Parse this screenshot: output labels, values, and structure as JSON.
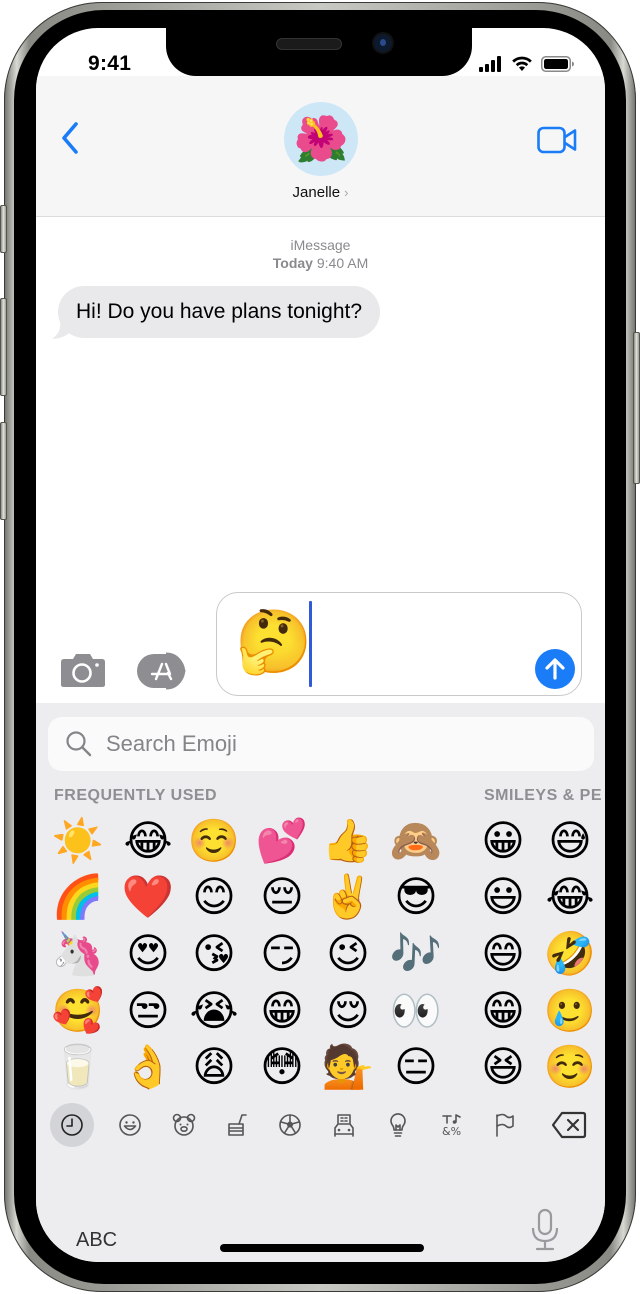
{
  "status_bar": {
    "time": "9:41",
    "icons": [
      "cellular-signal-icon",
      "wifi-icon",
      "battery-icon"
    ]
  },
  "header": {
    "back_icon": "chevron-left-icon",
    "contact": {
      "avatar_emoji": "🌺",
      "name": "Janelle",
      "chevron": "›"
    },
    "video_icon": "video-camera-icon"
  },
  "conversation": {
    "service": "iMessage",
    "timestamp_day": "Today",
    "timestamp_time": "9:40 AM",
    "messages": [
      {
        "direction": "incoming",
        "text": "Hi! Do you have plans tonight?"
      }
    ]
  },
  "composer": {
    "camera_icon": "camera-icon",
    "apps_icon": "app-store-icon",
    "input_value": "🤔",
    "send_icon": "arrow-up-icon"
  },
  "keyboard": {
    "search_placeholder": "Search Emoji",
    "sections": [
      {
        "label": "FREQUENTLY USED",
        "columns": [
          [
            "☀️",
            "🌈",
            "🦄",
            "🥰",
            "🥛"
          ],
          [
            "😂",
            "❤️",
            "😍",
            "😒",
            "👌"
          ],
          [
            "☺️",
            "😊",
            "😘",
            "😭",
            "😩"
          ],
          [
            "💕",
            "😔",
            "😏",
            "😁",
            "😳"
          ],
          [
            "👍",
            "✌️",
            "😉",
            "😌",
            "💁"
          ],
          [
            "🙈",
            "😎",
            "🎶",
            "👀",
            "😑"
          ]
        ]
      },
      {
        "label": "SMILEYS & PE",
        "columns": [
          [
            "😀",
            "😃",
            "😄",
            "😁",
            "😆"
          ],
          [
            "😅",
            "😂",
            "🤣",
            "🥲",
            "☺️"
          ]
        ]
      }
    ],
    "categories": [
      {
        "name": "recents",
        "icon": "clock-icon",
        "active": true
      },
      {
        "name": "smileys-people",
        "icon": "smiley-icon",
        "active": false
      },
      {
        "name": "animals-nature",
        "icon": "bear-icon",
        "active": false
      },
      {
        "name": "food-drink",
        "icon": "burger-icon",
        "active": false
      },
      {
        "name": "activity",
        "icon": "soccer-ball-icon",
        "active": false
      },
      {
        "name": "travel-places",
        "icon": "car-building-icon",
        "active": false
      },
      {
        "name": "objects",
        "icon": "lightbulb-icon",
        "active": false
      },
      {
        "name": "symbols",
        "icon": "symbols-icon",
        "active": false
      },
      {
        "name": "flags",
        "icon": "flag-icon",
        "active": false
      }
    ],
    "delete_icon": "delete-backspace-icon",
    "abc_label": "ABC",
    "mic_icon": "microphone-icon"
  },
  "colors": {
    "accent_blue": "#1a7cf7",
    "bubble_gray": "#e9e9eb",
    "keyboard_bg": "#ededf0",
    "caret_blue": "#2f5bd9"
  }
}
